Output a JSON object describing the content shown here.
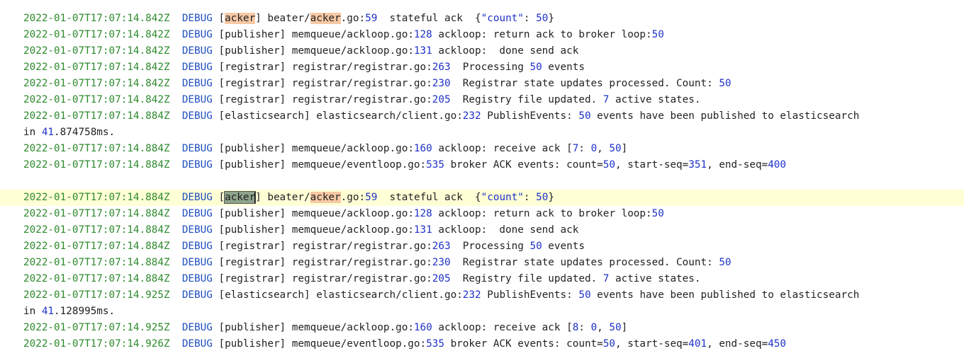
{
  "entries": [
    {
      "ts": "2022-01-07T17:07:14.842Z",
      "level": "DEBUG",
      "mod": "acker",
      "file_pre": "beater/",
      "file_hl": "acker",
      "file_post": ".go",
      "line": "59",
      "msg_a": "  stateful ack  {",
      "msg_b": "\"count\"",
      "msg_c": ": ",
      "msg_d": "50",
      "msg_e": "}"
    },
    {
      "ts": "2022-01-07T17:07:14.842Z",
      "level": "DEBUG",
      "mod": "publisher",
      "file": "memqueue/ackloop.go",
      "line": "128",
      "msg_a": " ackloop: return ack to broker loop:",
      "msg_d": "50"
    },
    {
      "ts": "2022-01-07T17:07:14.842Z",
      "level": "DEBUG",
      "mod": "publisher",
      "file": "memqueue/ackloop.go",
      "line": "131",
      "msg_a": " ackloop:  done send ack"
    },
    {
      "ts": "2022-01-07T17:07:14.842Z",
      "level": "DEBUG",
      "mod": "registrar",
      "file": "registrar/registrar.go",
      "line": "263",
      "msg_a": "  Processing ",
      "msg_d": "50",
      "msg_e": " events"
    },
    {
      "ts": "2022-01-07T17:07:14.842Z",
      "level": "DEBUG",
      "mod": "registrar",
      "file": "registrar/registrar.go",
      "line": "230",
      "msg_a": "  Registrar state updates processed. Count: ",
      "msg_d": "50"
    },
    {
      "ts": "2022-01-07T17:07:14.842Z",
      "level": "DEBUG",
      "mod": "registrar",
      "file": "registrar/registrar.go",
      "line": "205",
      "msg_a": "  Registry file updated. ",
      "msg_d": "7",
      "msg_e": " active states."
    },
    {
      "ts": "2022-01-07T17:07:14.884Z",
      "level": "DEBUG",
      "mod": "elasticsearch",
      "file": "elasticsearch/client.go",
      "line": "232",
      "msg_a": " PublishEvents: ",
      "msg_d": "50",
      "msg_e": " events have been published to elasticsearch",
      "cont_a": "in ",
      "cont_num": "41",
      "cont_b": ".874758ms."
    },
    {
      "ts": "2022-01-07T17:07:14.884Z",
      "level": "DEBUG",
      "mod": "publisher",
      "file": "memqueue/ackloop.go",
      "line": "160",
      "msg_a": " ackloop: receive ack [",
      "msg_d": "7",
      "msg_e": ": ",
      "msg_f": "0",
      "msg_g": ", ",
      "msg_h": "50",
      "msg_i": "]"
    },
    {
      "ts": "2022-01-07T17:07:14.884Z",
      "level": "DEBUG",
      "mod": "publisher",
      "file": "memqueue/eventloop.go",
      "line": "535",
      "msg_a": " broker ACK events: count=",
      "msg_d": "50",
      "msg_e": ", start-seq=",
      "msg_f": "351",
      "msg_g": ", end-seq=",
      "msg_h": "400"
    },
    {
      "ts": "2022-01-07T17:07:14.884Z",
      "level": "DEBUG",
      "mod": "acker",
      "file_pre": "beater/",
      "file_hl": "acker",
      "file_post": ".go",
      "line": "59",
      "msg_a": "  stateful ack  {",
      "msg_b": "\"count\"",
      "msg_c": ": ",
      "msg_d": "50",
      "msg_e": "}"
    },
    {
      "ts": "2022-01-07T17:07:14.884Z",
      "level": "DEBUG",
      "mod": "publisher",
      "file": "memqueue/ackloop.go",
      "line": "128",
      "msg_a": " ackloop: return ack to broker loop:",
      "msg_d": "50"
    },
    {
      "ts": "2022-01-07T17:07:14.884Z",
      "level": "DEBUG",
      "mod": "publisher",
      "file": "memqueue/ackloop.go",
      "line": "131",
      "msg_a": " ackloop:  done send ack"
    },
    {
      "ts": "2022-01-07T17:07:14.884Z",
      "level": "DEBUG",
      "mod": "registrar",
      "file": "registrar/registrar.go",
      "line": "263",
      "msg_a": "  Processing ",
      "msg_d": "50",
      "msg_e": " events"
    },
    {
      "ts": "2022-01-07T17:07:14.884Z",
      "level": "DEBUG",
      "mod": "registrar",
      "file": "registrar/registrar.go",
      "line": "230",
      "msg_a": "  Registrar state updates processed. Count: ",
      "msg_d": "50"
    },
    {
      "ts": "2022-01-07T17:07:14.884Z",
      "level": "DEBUG",
      "mod": "registrar",
      "file": "registrar/registrar.go",
      "line": "205",
      "msg_a": "  Registry file updated. ",
      "msg_d": "7",
      "msg_e": " active states."
    },
    {
      "ts": "2022-01-07T17:07:14.925Z",
      "level": "DEBUG",
      "mod": "elasticsearch",
      "file": "elasticsearch/client.go",
      "line": "232",
      "msg_a": " PublishEvents: ",
      "msg_d": "50",
      "msg_e": " events have been published to elasticsearch",
      "cont_a": "in ",
      "cont_num": "41",
      "cont_b": ".128995ms."
    },
    {
      "ts": "2022-01-07T17:07:14.925Z",
      "level": "DEBUG",
      "mod": "publisher",
      "file": "memqueue/ackloop.go",
      "line": "160",
      "msg_a": " ackloop: receive ack [",
      "msg_d": "8",
      "msg_e": ": ",
      "msg_f": "0",
      "msg_g": ", ",
      "msg_h": "50",
      "msg_i": "]"
    },
    {
      "ts": "2022-01-07T17:07:14.926Z",
      "level": "DEBUG",
      "mod": "publisher",
      "file": "memqueue/eventloop.go",
      "line": "535",
      "msg_a": " broker ACK events: count=",
      "msg_d": "50",
      "msg_e": ", start-seq=",
      "msg_f": "401",
      "msg_g": ", end-seq=",
      "msg_h": "450"
    }
  ]
}
